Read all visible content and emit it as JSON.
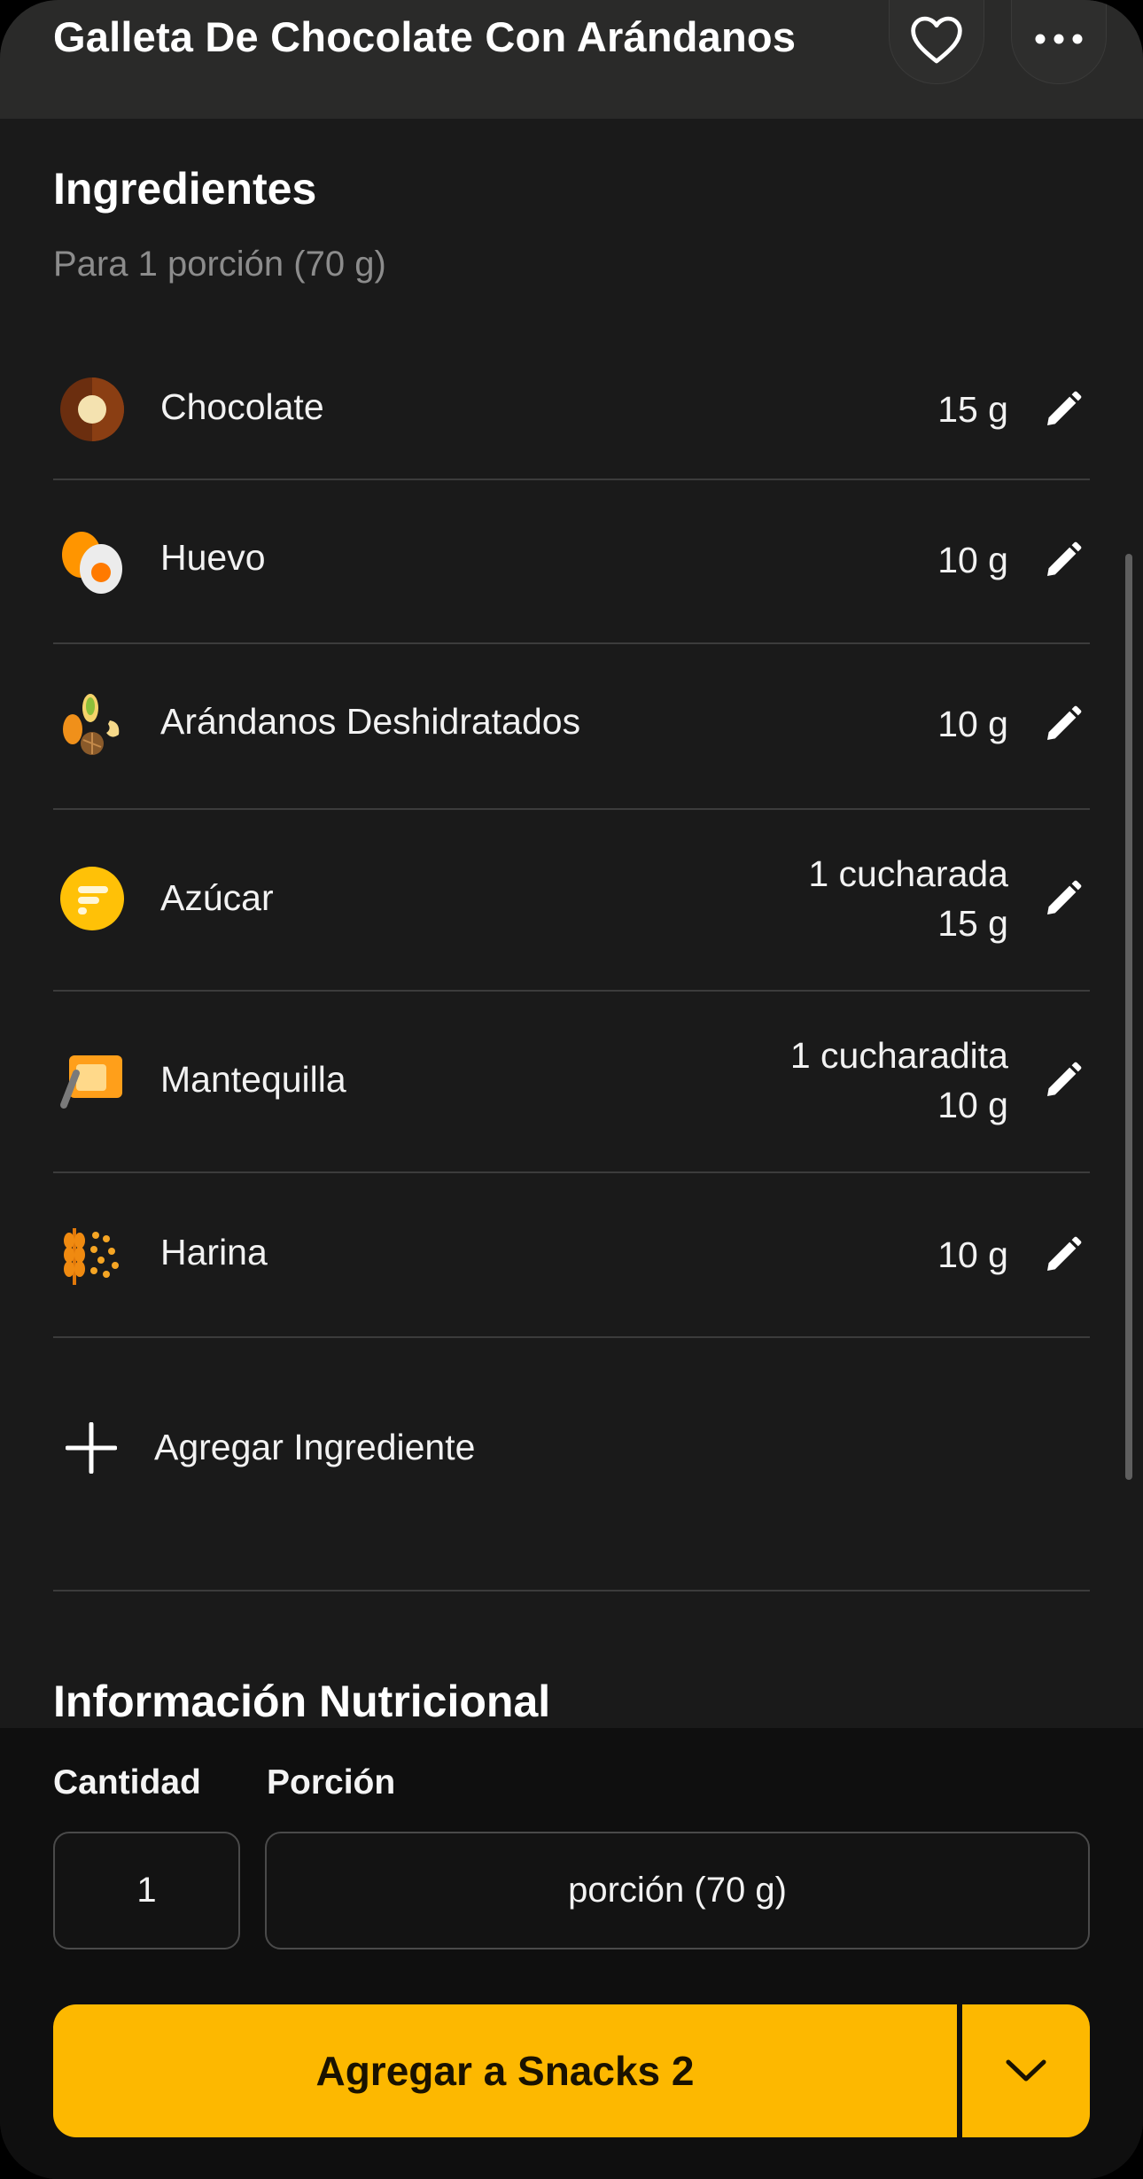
{
  "header": {
    "title": "Galleta De Chocolate Con Arándanos",
    "favorite_icon": "heart-outline-icon",
    "more_icon": "ellipsis-icon"
  },
  "ingredients": {
    "title": "Ingredientes",
    "subtitle": "Para 1 porción (70 g)",
    "items": [
      {
        "name": "Chocolate",
        "qty_line1": "15 g",
        "qty_line2": "",
        "icon": "chocolate-icon"
      },
      {
        "name": "Huevo",
        "qty_line1": "10 g",
        "qty_line2": "",
        "icon": "egg-icon"
      },
      {
        "name": "Arándanos Deshidratados",
        "qty_line1": "10 g",
        "qty_line2": "",
        "icon": "nuts-seeds-icon"
      },
      {
        "name": "Azúcar",
        "qty_line1": "1 cucharada",
        "qty_line2": "15 g",
        "icon": "sugar-icon"
      },
      {
        "name": "Mantequilla",
        "qty_line1": "1 cucharadita",
        "qty_line2": "10 g",
        "icon": "butter-icon"
      },
      {
        "name": "Harina",
        "qty_line1": "10 g",
        "qty_line2": "",
        "icon": "wheat-icon"
      }
    ],
    "add_label": "Agregar Ingrediente"
  },
  "nutrition": {
    "title": "Información Nutricional"
  },
  "footer": {
    "quantity_label": "Cantidad",
    "portion_label": "Porción",
    "quantity_value": "1",
    "portion_value": "porción (70 g)",
    "add_button": "Agregar a Snacks 2"
  },
  "colors": {
    "accent": "#fdb800",
    "background": "#1a1a1a",
    "divider": "#3c3c3c"
  }
}
